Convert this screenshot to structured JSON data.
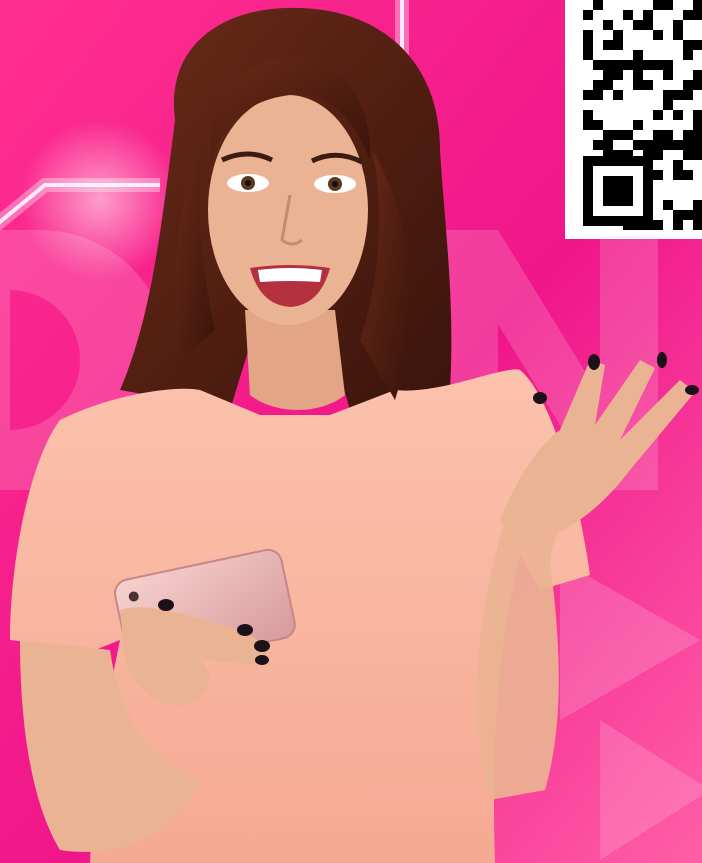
{
  "scene": {
    "background_colors": [
      "#ff2f8f",
      "#f0168a",
      "#ff5fa8"
    ],
    "neon_line_color": "#ffe8ff",
    "watermark_letters": "ON",
    "subject": {
      "shirt_color": "#f8b49e",
      "hair_color": "#4a1d12",
      "skin_color": "#eab393",
      "nail_color": "#1a1216",
      "phone_color": "#e8aeae"
    }
  },
  "qr_code": {
    "foreground": "#000000",
    "background": "#ffffff"
  }
}
